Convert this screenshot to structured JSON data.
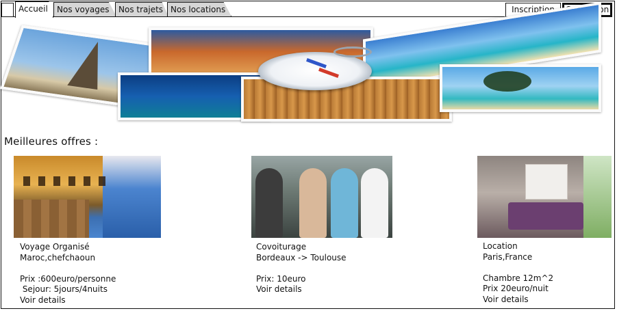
{
  "tabs": [
    {
      "label": "Accueil"
    },
    {
      "label": "Nos voyages"
    },
    {
      "label": "Nos trajets"
    },
    {
      "label": "Nos locations"
    }
  ],
  "auth": {
    "inscription": "Inscription",
    "connexion": "Connexion"
  },
  "section_title": "Meilleures offres :",
  "offers": [
    {
      "category": "Voyage Organisé",
      "place": "Maroc,chefchaoun",
      "line1": "Prix :600euro/personne",
      "line2": " Sejour: 5jours/4nuits",
      "link": "Voir details"
    },
    {
      "category": "Covoiturage",
      "place": "Bordeaux -> Toulouse",
      "line1": "Prix: 10euro",
      "link": "Voir details"
    },
    {
      "category": "Location",
      "place": "Paris,France",
      "line1": "Chambre 12m^2",
      "line2": "Prix 20euro/nuit",
      "link": "Voir details"
    }
  ]
}
